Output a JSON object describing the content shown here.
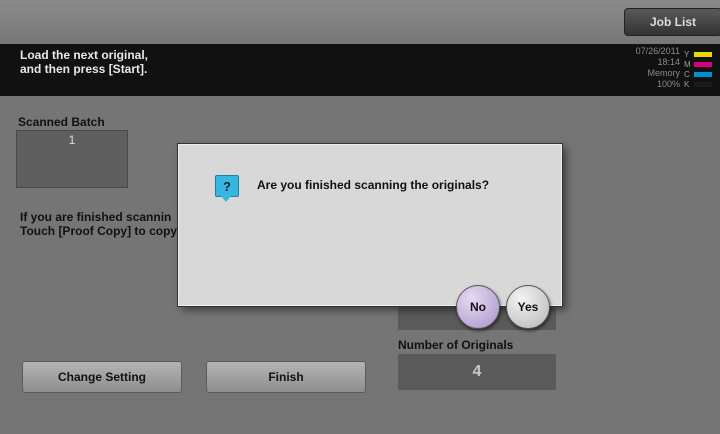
{
  "header": {
    "job_list_label": "Job List"
  },
  "message": {
    "line1": "Load the next original,",
    "line2": "and then press [Start]."
  },
  "status": {
    "date": "07/26/2011",
    "time": "18:14",
    "memory_label": "Memory",
    "memory_value": "100%",
    "toner": [
      {
        "label": "Y",
        "color": "#e8d800"
      },
      {
        "label": "M",
        "color": "#d8007a"
      },
      {
        "label": "C",
        "color": "#0090d8"
      },
      {
        "label": "K",
        "color": "#1a1a1a"
      }
    ]
  },
  "scanned_batch": {
    "label": "Scanned Batch",
    "value": "1"
  },
  "info": {
    "line1": "If you are finished scannin",
    "line2": "Touch [Proof Copy] to copy"
  },
  "buttons": {
    "change_setting": "Change Setting",
    "finish": "Finish"
  },
  "originals": {
    "label": "Number of Originals",
    "value": "4"
  },
  "dialog": {
    "icon": "question-icon",
    "question": "Are you finished scanning the originals?",
    "no_label": "No",
    "yes_label": "Yes"
  }
}
